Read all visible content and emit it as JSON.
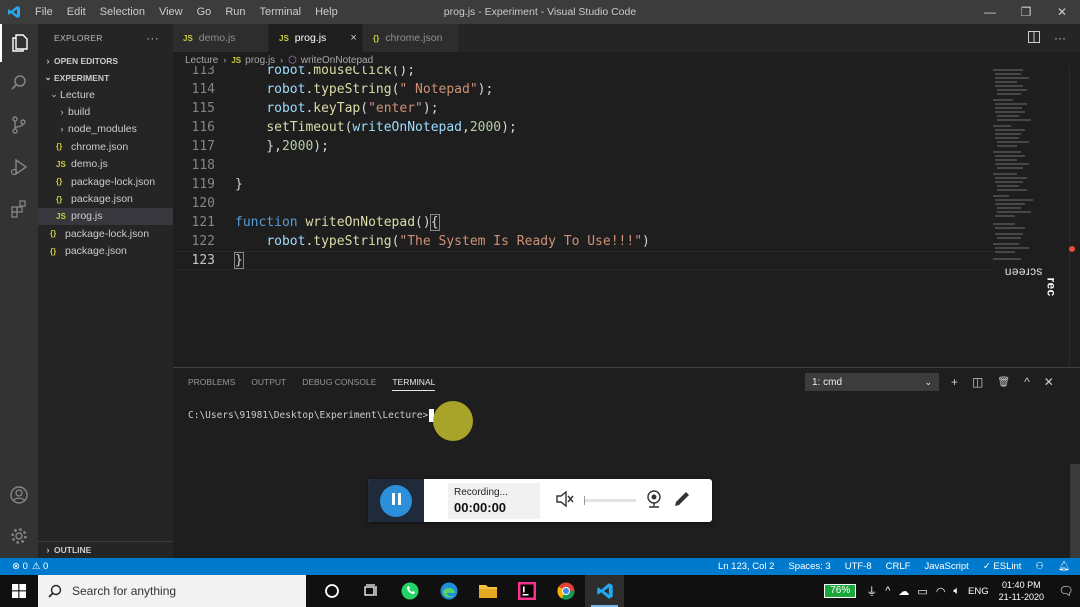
{
  "window": {
    "title": "prog.js - Experiment - Visual Studio Code",
    "menu": [
      "File",
      "Edit",
      "Selection",
      "View",
      "Go",
      "Run",
      "Terminal",
      "Help"
    ],
    "controls": [
      "—",
      "❐",
      "✕"
    ]
  },
  "sidebar": {
    "header": "EXPLORER",
    "more": "···",
    "open_editors": "OPEN EDITORS",
    "root": "EXPERIMENT",
    "items": [
      {
        "label": "Lecture",
        "type": "folder-open"
      },
      {
        "label": "build",
        "type": "folder"
      },
      {
        "label": "node_modules",
        "type": "folder"
      },
      {
        "label": "chrome.json",
        "type": "json"
      },
      {
        "label": "demo.js",
        "type": "js"
      },
      {
        "label": "package-lock.json",
        "type": "json"
      },
      {
        "label": "package.json",
        "type": "json"
      },
      {
        "label": "prog.js",
        "type": "js"
      },
      {
        "label": "package-lock.json",
        "type": "json"
      },
      {
        "label": "package.json",
        "type": "json"
      }
    ],
    "outline": "OUTLINE"
  },
  "tabs": [
    {
      "label": "demo.js",
      "icon": "JS"
    },
    {
      "label": "prog.js",
      "icon": "JS",
      "close": "×"
    },
    {
      "label": "chrome.json",
      "icon": "{}"
    }
  ],
  "breadcrumb": {
    "folder": "Lecture",
    "file": "prog.js",
    "symbol": "writeOnNotepad"
  },
  "editor": {
    "lines": [
      {
        "n": "113",
        "t": [
          "    ",
          "robot",
          ".",
          "mouseClick",
          "();"
        ]
      },
      {
        "n": "114",
        "t": [
          "    ",
          "robot",
          ".",
          "typeString",
          "(",
          "\" Notepad\"",
          ");"
        ]
      },
      {
        "n": "115",
        "t": [
          "    ",
          "robot",
          ".",
          "keyTap",
          "(",
          "\"enter\"",
          ");"
        ]
      },
      {
        "n": "116",
        "t": [
          "    ",
          "setTimeout",
          "(",
          "writeOnNotepad",
          ",",
          "2000",
          ");"
        ]
      },
      {
        "n": "117",
        "t": [
          "    },",
          "2000",
          ");"
        ]
      },
      {
        "n": "118",
        "t": [
          ""
        ]
      },
      {
        "n": "119",
        "t": [
          "}"
        ]
      },
      {
        "n": "120",
        "t": [
          ""
        ]
      },
      {
        "n": "121",
        "t": [
          "function",
          " ",
          "writeOnNotepad",
          "()",
          "{"
        ]
      },
      {
        "n": "122",
        "t": [
          "    ",
          "robot",
          ".",
          "typeString",
          "(",
          "\"The System Is Ready To Use!!!\"",
          ")"
        ]
      },
      {
        "n": "123",
        "t": [
          "}"
        ]
      }
    ]
  },
  "panel": {
    "tabs": [
      "PROBLEMS",
      "OUTPUT",
      "DEBUG CONSOLE",
      "TERMINAL"
    ],
    "active_tab": "TERMINAL",
    "terminal_select": "1: cmd",
    "actions": [
      "+",
      "◫",
      "🗑",
      "^",
      "✕"
    ],
    "prompt": "C:\\Users\\91981\\Desktop\\Experiment\\Lecture>"
  },
  "recorder": {
    "status": "Recording...",
    "time": "00:00:00"
  },
  "watermark": {
    "brand_a": "screen",
    "brand_b": "rec"
  },
  "statusbar": {
    "errors": "⊗ 0",
    "warnings": "⚠ 0",
    "position": "Ln 123, Col 2",
    "spaces": "Spaces: 3",
    "encoding": "UTF-8",
    "eol": "CRLF",
    "language": "JavaScript",
    "eslint": "✓ ESLint"
  },
  "taskbar": {
    "search_placeholder": "Search for anything",
    "battery": "76%",
    "lang": "ENG",
    "time": "01:40 PM",
    "date": "21-11-2020"
  },
  "colors": {
    "accent": "#007acc",
    "titlebar": "#3c3c3c",
    "sidebar": "#252526",
    "editor_bg": "#1e1e1e",
    "record_blue": "#2b90d9",
    "battery_green": "#1aa73b"
  }
}
